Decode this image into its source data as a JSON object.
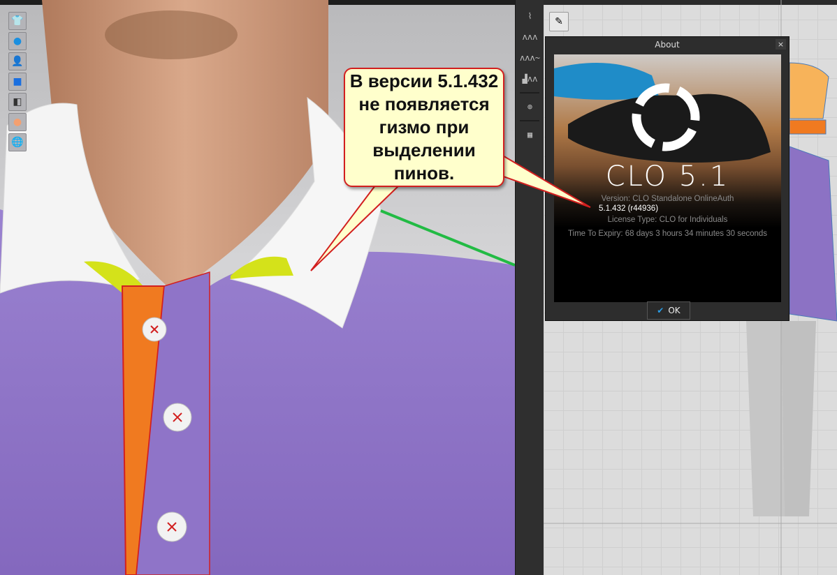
{
  "viewport3d": {
    "tools": [
      "show-garment-icon",
      "show-pins-icon",
      "show-avatar-icon",
      "select-garment-icon",
      "texture-icon",
      "avatar-icon",
      "world-icon"
    ]
  },
  "middle_toolbar": {
    "tools": [
      "edit-sewing-icon",
      "segment-sewing-icon",
      "free-sewing-icon",
      "sewing-machine-icon",
      "add-pattern-icon",
      "select-mesh-icon"
    ]
  },
  "callout": {
    "text": "В версии 5.1.432 не появляется гизмо при выделении пинов."
  },
  "about": {
    "title": "About",
    "close": "×",
    "logo": "CLO 5.1",
    "version_label": "Version: CLO Standalone OnlineAuth",
    "version_number": "5.1.432 (r44936)",
    "license": "License Type: CLO for Individuals",
    "expiry": "Time To Expiry: 68 days 3 hours 34 minutes 30 seconds",
    "ok_label": "OK"
  },
  "colors": {
    "shirt": "#8c72c4",
    "placket": "#f07a20",
    "callout_border": "#d21f1f",
    "callout_bg": "#ffffcc"
  }
}
